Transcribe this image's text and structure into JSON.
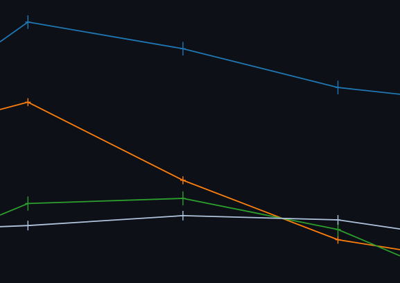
{
  "chart_data": {
    "type": "line",
    "x_domain": [
      -0.18,
      2.4
    ],
    "y_domain": [
      0,
      100
    ],
    "x": [
      0,
      1,
      2
    ],
    "series": [
      {
        "color": "#1f77b4",
        "values": [
          92.2,
          82.8,
          69.1
        ],
        "entry_value": 85.2,
        "exit_value": 66.7,
        "error": 2.4
      },
      {
        "color": "#ff7f0e",
        "values": [
          63.9,
          36.3,
          15.3
        ],
        "entry_value": 61.3,
        "exit_value": 11.8,
        "error": 1.4
      },
      {
        "color": "#2ca02c",
        "values": [
          28.1,
          29.9,
          18.9
        ],
        "entry_value": 24.0,
        "exit_value": 9.6,
        "error": 2.5
      },
      {
        "color": "#b0c4de",
        "values": [
          20.3,
          23.8,
          22.3
        ],
        "entry_value": 19.9,
        "exit_value": 19.1,
        "error": 1.7
      }
    ]
  }
}
